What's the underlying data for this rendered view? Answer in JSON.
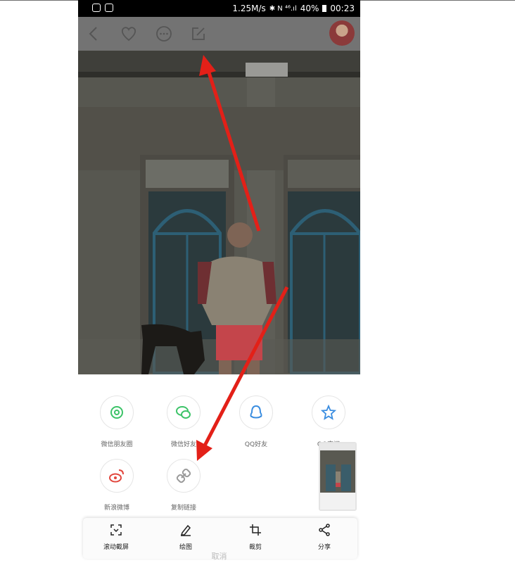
{
  "status_bar": {
    "net_speed": "1.25M/s",
    "indicators": "✱ N ⁴⁶.ıl",
    "battery": "40%",
    "time": "00:23"
  },
  "toolbar": {
    "icons": [
      "back-icon",
      "heart-icon",
      "more-icon",
      "edit-icon"
    ]
  },
  "share_options": [
    {
      "label": "微信朋友圈",
      "icon": "moments-icon",
      "color": "#3cc368"
    },
    {
      "label": "微信好友",
      "icon": "wechat-icon",
      "color": "#3cc368"
    },
    {
      "label": "QQ好友",
      "icon": "qq-icon",
      "color": "#3a8de0"
    },
    {
      "label": "QQ空间",
      "icon": "qzone-icon",
      "color": "#3a8de0"
    },
    {
      "label": "新浪微博",
      "icon": "weibo-icon",
      "color": "#e2463d"
    },
    {
      "label": "复制链接",
      "icon": "link-icon",
      "color": "#999999"
    }
  ],
  "actions": [
    {
      "label": "滚动截屏",
      "icon": "scroll-capture-icon"
    },
    {
      "label": "绘图",
      "icon": "draw-icon"
    },
    {
      "label": "裁剪",
      "icon": "crop-icon"
    },
    {
      "label": "分享",
      "icon": "share-icon"
    }
  ],
  "cancel_label": "取消",
  "colors": {
    "annotation_arrow": "#e32018",
    "toolbar_bg": "#737373"
  }
}
